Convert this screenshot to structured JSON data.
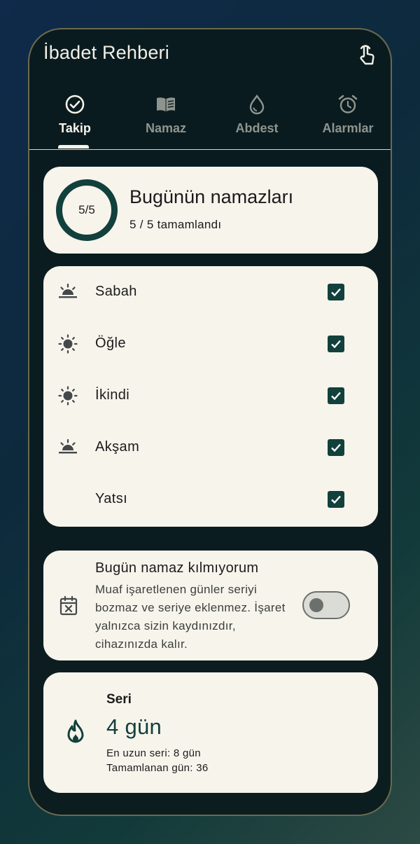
{
  "app": {
    "title": "İbadet Rehberi"
  },
  "tabs": [
    {
      "label": "Takip",
      "icon": "check-circle-icon",
      "active": true
    },
    {
      "label": "Namaz",
      "icon": "book-icon",
      "active": false
    },
    {
      "label": "Abdest",
      "icon": "water-drop-icon",
      "active": false
    },
    {
      "label": "Alarmlar",
      "icon": "alarm-clock-icon",
      "active": false
    }
  ],
  "summary": {
    "ring_text": "5/5",
    "title": "Bugünün namazları",
    "subtitle": "5 / 5 tamamlandı",
    "completed": 5,
    "total": 5
  },
  "prayers": [
    {
      "name": "Sabah",
      "icon": "sunrise-icon",
      "checked": true
    },
    {
      "name": "Öğle",
      "icon": "sun-icon",
      "checked": true
    },
    {
      "name": "İkindi",
      "icon": "sun-icon",
      "checked": true
    },
    {
      "name": "Akşam",
      "icon": "sunset-icon",
      "checked": true
    },
    {
      "name": "Yatsı",
      "icon": "moon-icon",
      "checked": true
    }
  ],
  "exempt": {
    "title": "Bugün namaz kılmıyorum",
    "description": "Muaf işaretlenen günler seriyi bozmaz ve seriye eklenmez. İşaret yalnızca sizin kaydınızdır, cihazınızda kalır.",
    "toggle_on": false,
    "icon": "calendar-x-icon"
  },
  "streak": {
    "label": "Seri",
    "value": "4 gün",
    "longest": "En uzun seri: 8 gün",
    "total": "Tamamlanan gün: 36",
    "icon": "flame-icon"
  },
  "colors": {
    "accent": "#12403c",
    "card": "#f7f4ec",
    "screen": "#0b1c20"
  }
}
